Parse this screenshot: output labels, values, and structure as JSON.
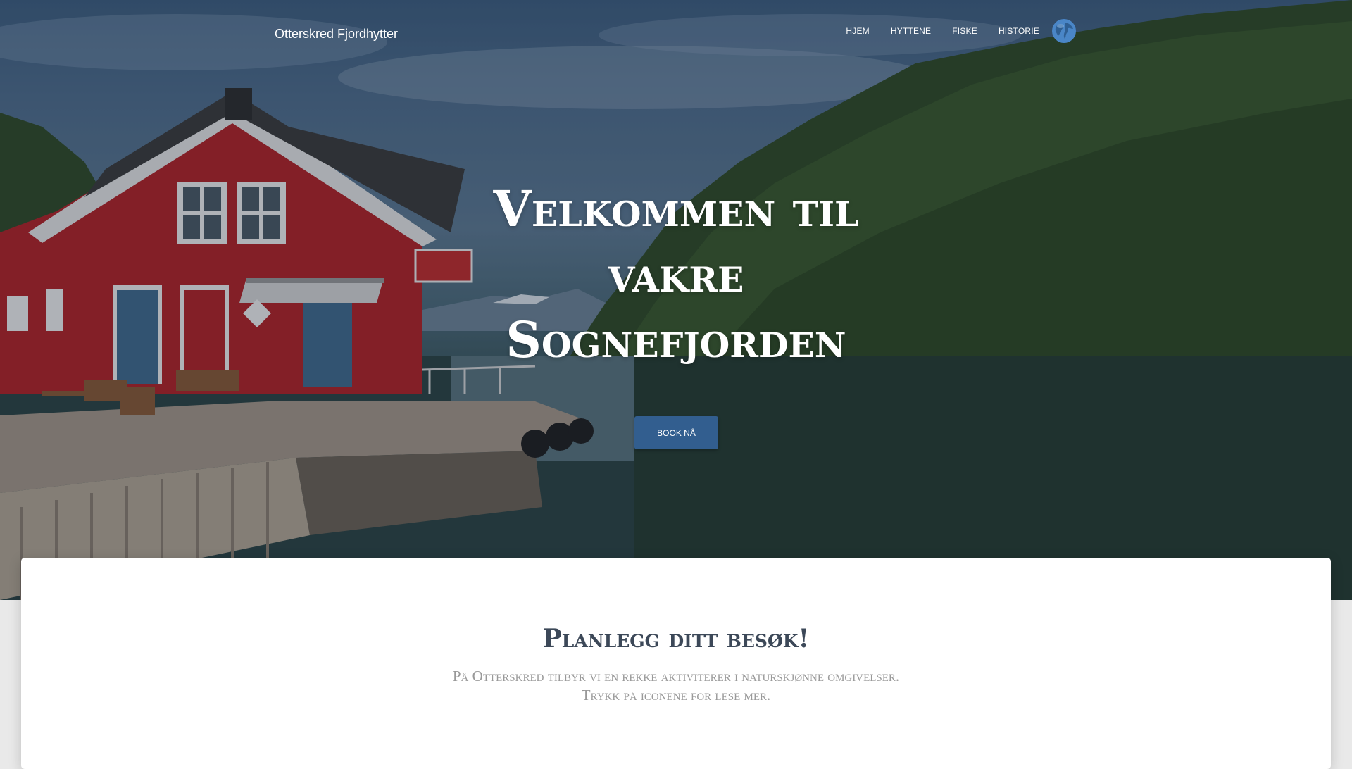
{
  "brand": "Otterskred Fjordhytter",
  "nav": {
    "items": [
      {
        "label": "HJEM"
      },
      {
        "label": "HYTTENE"
      },
      {
        "label": "FISKE"
      },
      {
        "label": "HISTORIE"
      }
    ],
    "language_icon": "globe-icon"
  },
  "hero": {
    "title_line1": "Velkommen til",
    "title_line2": "vakre",
    "title_line3": "Sognefjorden",
    "cta_label": "BOOK NÅ"
  },
  "section": {
    "title": "Planlegg ditt besøk!",
    "subtitle_line1": "På Otterskred tilbyr vi en rekke aktiviterer i naturskjønne omgivelser.",
    "subtitle_line2": "Trykk på iconene for lese mer."
  },
  "colors": {
    "cta_background": "#325e8f",
    "section_title": "#3c4858",
    "section_subtitle": "#999999",
    "house_red": "#b32024"
  }
}
